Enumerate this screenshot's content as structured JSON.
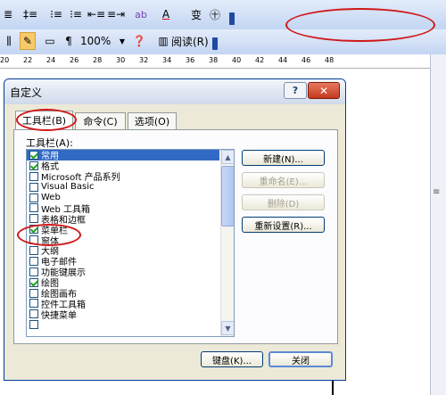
{
  "toolbar1": {
    "align_text": "≣",
    "line_spacing": "‡≡",
    "numbering": "⁝≡",
    "bullets": "⁝≡",
    "decrease_indent": "⇤≡",
    "increase_indent": "≡⇥",
    "highlight": "ab",
    "font_color": "A",
    "phonetic": "变",
    "enclose": "㊉"
  },
  "toolbar2": {
    "columns": "⫼",
    "drawing_icon": "✎",
    "zoom": "100%",
    "read_label": "阅读(R)"
  },
  "ruler": {
    "ticks": [
      "20",
      "22",
      "24",
      "26",
      "28",
      "30",
      "32",
      "34",
      "36",
      "38",
      "40",
      "42",
      "44",
      "46",
      "48"
    ]
  },
  "dialog": {
    "title": "自定义",
    "help_label": "?",
    "close_label": "✕",
    "tabs": {
      "toolbars": "工具栏(B)",
      "commands": "命令(C)",
      "options": "选项(O)"
    },
    "toolbars_label": "工具栏(A):",
    "list": [
      {
        "label": "常用",
        "checked": true,
        "selected": true
      },
      {
        "label": "格式",
        "checked": true
      },
      {
        "label": "Microsoft 产品系列",
        "checked": false
      },
      {
        "label": "Visual Basic",
        "checked": false
      },
      {
        "label": "Web",
        "checked": false
      },
      {
        "label": "Web 工具箱",
        "checked": false
      },
      {
        "label": "表格和边框",
        "checked": false
      },
      {
        "label": "菜单栏",
        "checked": true
      },
      {
        "label": "窗体",
        "checked": false
      },
      {
        "label": "大纲",
        "checked": false
      },
      {
        "label": "电子邮件",
        "checked": false
      },
      {
        "label": "功能键展示",
        "checked": false
      },
      {
        "label": "绘图",
        "checked": true
      },
      {
        "label": "绘图画布",
        "checked": false
      },
      {
        "label": "控件工具箱",
        "checked": false
      },
      {
        "label": "快捷菜单",
        "checked": false
      },
      {
        "label": "",
        "checked": false
      }
    ],
    "buttons": {
      "new": "新建(N)...",
      "rename": "重命名(E)...",
      "delete": "删除(D)",
      "reset": "重新设置(R)...",
      "keyboard": "键盘(K)...",
      "close": "关闭"
    }
  }
}
